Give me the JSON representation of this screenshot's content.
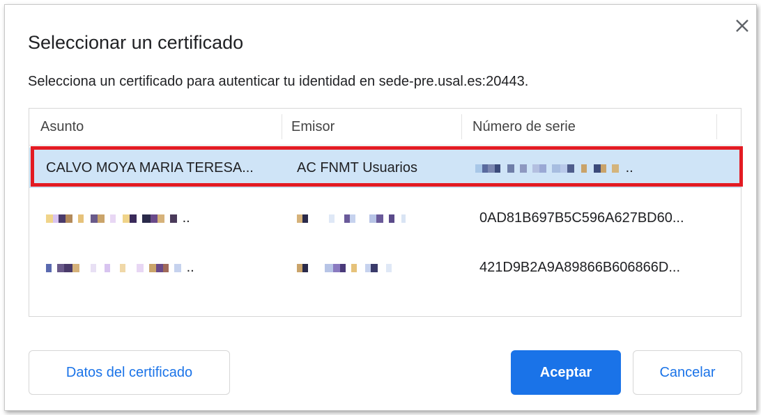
{
  "dialog": {
    "title": "Seleccionar un certificado",
    "description": "Selecciona un certificado para autenticar tu identidad en sede-pre.usal.es:20443.",
    "close_icon": "close-icon"
  },
  "table": {
    "columns": [
      "Asunto",
      "Emisor",
      "Número de serie"
    ],
    "rows": [
      {
        "subject": "CALVO MOYA MARIA TERESA...",
        "issuer": "AC FNMT Usuarios",
        "serial": "…",
        "selected": true
      },
      {
        "subject": "…",
        "issuer": "…",
        "serial": "0AD81B697B5C596A627BD60...",
        "selected": false
      },
      {
        "subject": "…",
        "issuer": "…",
        "serial": "421D9B2A9A89866B606866D...",
        "selected": false
      }
    ]
  },
  "buttons": {
    "details": "Datos del certificado",
    "accept": "Aceptar",
    "cancel": "Cancelar"
  },
  "colors": {
    "accent": "#1a73e8",
    "selected_row": "#cfe4f7",
    "highlight_border": "#e31b23"
  }
}
